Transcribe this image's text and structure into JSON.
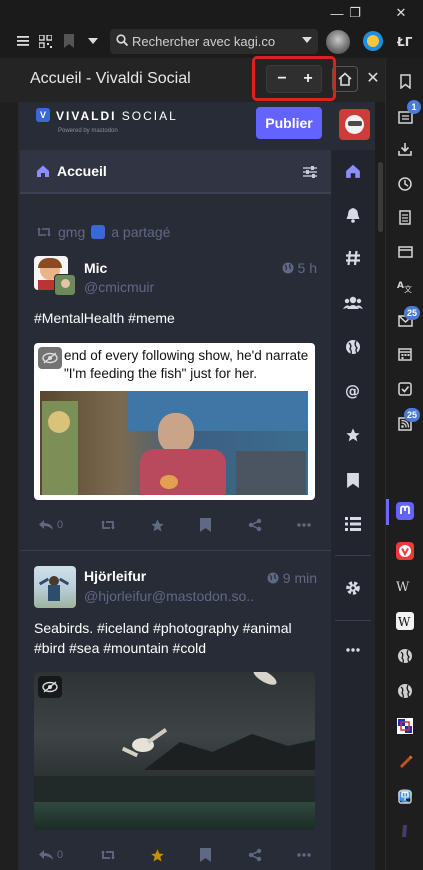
{
  "window": {
    "minimize": "—",
    "restore": "❐",
    "close": "✕"
  },
  "toolbar": {
    "search_placeholder": "Rechercher avec kagi.co"
  },
  "panel": {
    "title": "Accueil - Vivaldi Social",
    "zoom_out": "−",
    "zoom_in": "+",
    "close": "✕"
  },
  "mastodon": {
    "logo_brand": "VIVALDI",
    "logo_social": "SOCIAL",
    "powered_by": "Powered by mastodon",
    "publish_label": "Publier",
    "column_title": "Accueil",
    "posts": [
      {
        "boost_user": "gmg",
        "boost_label": "a partagé",
        "name": "Mic",
        "handle": "@cmicmuir",
        "time": "5 h",
        "text": "#MentalHealth #meme",
        "media_caption": "end of every following show, he'd narrate \"I'm feeding the fish\" just for her.",
        "replies": "0"
      },
      {
        "name": "Hjörleifur",
        "handle": "@hjorleifur@mastodon.so...",
        "time": "9 min",
        "text": "Seabirds. #iceland #photography #animal #bird #sea #mountain #cold",
        "replies": "0"
      }
    ]
  },
  "sidebar_badges": {
    "reading_list": "1",
    "mail": "25",
    "feeds": "25"
  },
  "colors": {
    "accent_highlight": "#e01f1f",
    "publish_button": "#6364ff",
    "mastodon_bg": "#282c37",
    "badge": "#4a7bd6",
    "favourite_star": "#ca8f04"
  }
}
